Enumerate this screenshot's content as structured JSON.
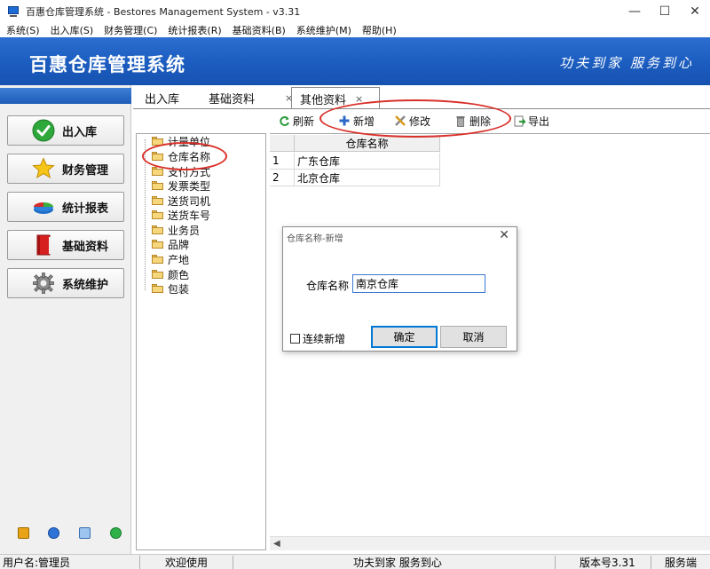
{
  "window": {
    "title": "百惠仓库管理系统 - Bestores Management System - v3.31",
    "controls": [
      "—",
      "☐",
      "✕"
    ]
  },
  "menu": [
    "系统(S)",
    "出入库(S)",
    "财务管理(C)",
    "统计报表(R)",
    "基础资料(B)",
    "系统维护(M)",
    "帮助(H)"
  ],
  "banner": {
    "title": "百惠仓库管理系统",
    "slogan": "功夫到家 服务到心"
  },
  "nav": [
    {
      "label": "出入库",
      "icon": "check-icon"
    },
    {
      "label": "财务管理",
      "icon": "star-icon"
    },
    {
      "label": "统计报表",
      "icon": "pie-chart-icon"
    },
    {
      "label": "基础资料",
      "icon": "book-icon"
    },
    {
      "label": "系统维护",
      "icon": "gear-icon"
    }
  ],
  "tabs": [
    {
      "label": "出入库",
      "closable": false,
      "active": false
    },
    {
      "label": "基础资料",
      "closable": true,
      "active": false
    },
    {
      "label": "其他资料",
      "closable": true,
      "active": true
    }
  ],
  "tab_close": "×",
  "toolbar": {
    "refresh": "刷新",
    "add": "新增",
    "edit": "修改",
    "delete": "删除",
    "export": "导出"
  },
  "tree": [
    "计量单位",
    "仓库名称",
    "支付方式",
    "发票类型",
    "送货司机",
    "送货车号",
    "业务员",
    "品牌",
    "产地",
    "颜色",
    "包装"
  ],
  "grid": {
    "header": "仓库名称",
    "rows": [
      {
        "num": "1",
        "name": "广东仓库"
      },
      {
        "num": "2",
        "name": "北京仓库"
      }
    ]
  },
  "dialog": {
    "title": "仓库名称-新增",
    "close": "✕",
    "field_label": "仓库名称",
    "field_value": "南京仓库",
    "checkbox_label": "连续新增",
    "ok": "确定",
    "cancel": "取消"
  },
  "status": {
    "user": "用户名:管理员",
    "welcome": "欢迎使用",
    "slogan": "功夫到家 服务到心",
    "version": "版本号3.31",
    "server": "服务端"
  },
  "colors": {
    "banner": "#1d5fc2",
    "annotation": "#d9302a"
  }
}
